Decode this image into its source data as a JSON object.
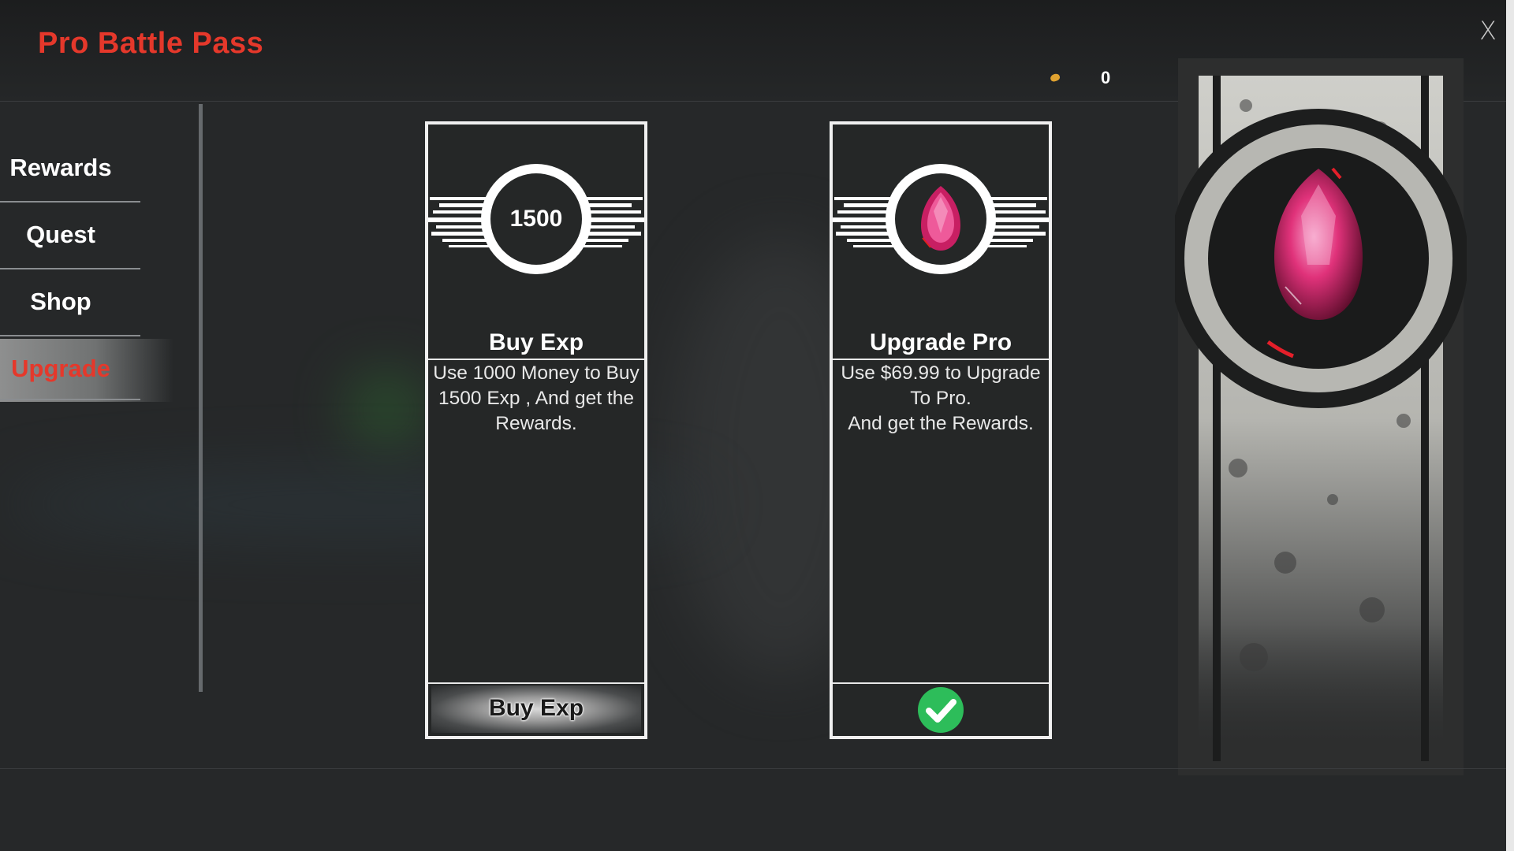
{
  "header": {
    "title": "Pro Battle Pass",
    "close_label": "X",
    "currency": {
      "icon": "coin-icon",
      "amount": "0"
    }
  },
  "sidebar": {
    "items": [
      {
        "label": "Rewards",
        "active": false
      },
      {
        "label": "Quest",
        "active": false
      },
      {
        "label": "Shop",
        "active": false
      },
      {
        "label": "Upgrade",
        "active": true
      }
    ]
  },
  "cards": {
    "buy_exp": {
      "emblem_value": "1500",
      "title": "Buy Exp",
      "description": "Use 1000 Money to Buy\n1500 Exp , And get the\nRewards.",
      "button_label": "Buy Exp"
    },
    "upgrade_pro": {
      "emblem_icon": "ruby-gem-icon",
      "title": "Upgrade Pro",
      "description": "Use $69.99 to Upgrade\nTo Pro.\nAnd get the Rewards.",
      "status_icon": "checkmark-icon"
    }
  },
  "colors": {
    "accent_red": "#e5382b",
    "check_green": "#2dbd5a",
    "gem_pink": "#e0327a"
  },
  "banner": {
    "icon": "ruby-gem-icon"
  }
}
